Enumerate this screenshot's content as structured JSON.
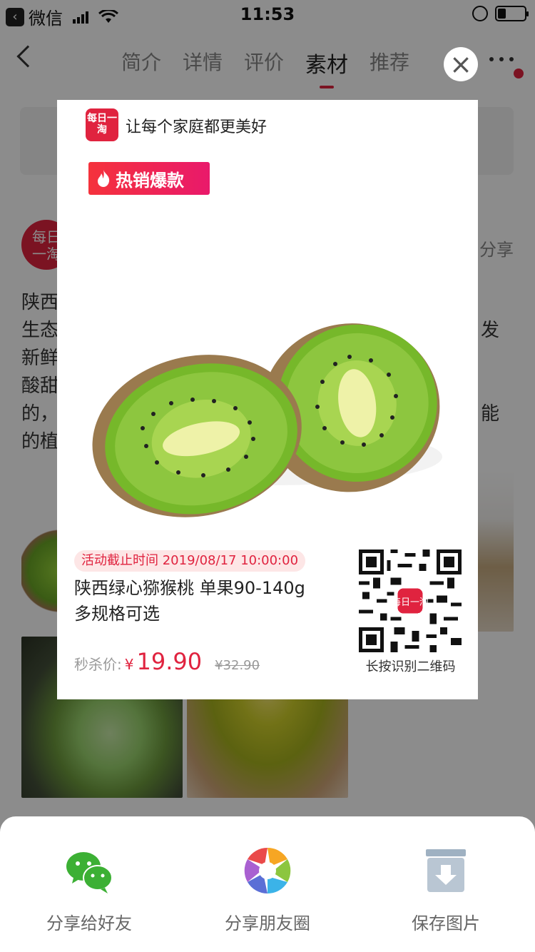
{
  "status_bar": {
    "back_app": "微信",
    "time": "11:53"
  },
  "nav": {
    "tabs": [
      {
        "label": "简介"
      },
      {
        "label": "详情"
      },
      {
        "label": "评价"
      },
      {
        "label": "素材"
      },
      {
        "label": "推荐"
      }
    ],
    "active_tab": "素材"
  },
  "background": {
    "brand_avatar_text": "每日一淘",
    "share_link": "分享",
    "desc_lines": [
      "陕西",
      "生态",
      "新鲜",
      "酸甜",
      "的，",
      "的植"
    ],
    "desc_right": [
      "发",
      "能"
    ]
  },
  "card": {
    "logo_text": "每日一淘",
    "slogan": "让每个家庭都更美好",
    "badge": "热销爆款",
    "deadline": "活动截止时间 2019/08/17 10:00:00",
    "title_line1": "陕西绿心猕猴桃  单果90-140g",
    "title_line2": "多规格可选",
    "price_label": "秒杀价:",
    "currency": "¥",
    "price": "19.90",
    "original_price": "¥32.90",
    "qr_caption": "长按识别二维码",
    "qr_logo_text": "每日一淘"
  },
  "share_sheet": {
    "items": [
      {
        "label": "分享给好友",
        "icon": "wechat-icon"
      },
      {
        "label": "分享朋友圈",
        "icon": "moments-icon"
      },
      {
        "label": "保存图片",
        "icon": "save-image-icon"
      }
    ]
  },
  "colors": {
    "accent": "#e0233f",
    "kiwi_green": "#8dc63f"
  }
}
